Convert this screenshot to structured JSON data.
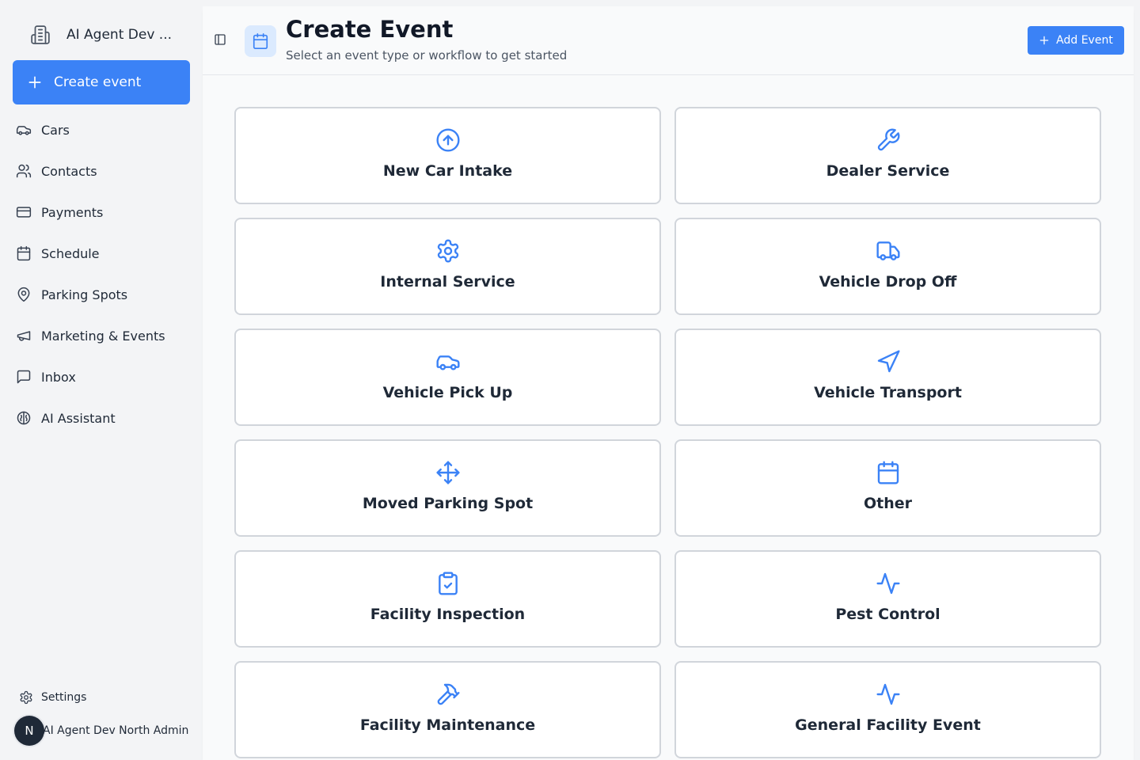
{
  "sidebar": {
    "org_name": "AI Agent Dev ...",
    "create_label": "Create event",
    "items": [
      {
        "label": "Cars",
        "icon": "car-icon"
      },
      {
        "label": "Contacts",
        "icon": "users-icon"
      },
      {
        "label": "Payments",
        "icon": "credit-card-icon"
      },
      {
        "label": "Schedule",
        "icon": "calendar-icon"
      },
      {
        "label": "Parking Spots",
        "icon": "map-pin-icon"
      },
      {
        "label": "Marketing & Events",
        "icon": "megaphone-icon"
      },
      {
        "label": "Inbox",
        "icon": "message-square-icon"
      },
      {
        "label": "AI Assistant",
        "icon": "brain-icon"
      }
    ],
    "settings_label": "Settings",
    "user_initial": "N",
    "user_name": "AI Agent Dev North Admin"
  },
  "header": {
    "title": "Create Event",
    "subtitle": "Select an event type or workflow to get started",
    "add_label": "Add Event"
  },
  "event_types": [
    {
      "label": "New Car Intake",
      "icon": "arrow-up-circle-icon"
    },
    {
      "label": "Dealer Service",
      "icon": "wrench-icon"
    },
    {
      "label": "Internal Service",
      "icon": "gear-icon"
    },
    {
      "label": "Vehicle Drop Off",
      "icon": "truck-icon"
    },
    {
      "label": "Vehicle Pick Up",
      "icon": "car-icon"
    },
    {
      "label": "Vehicle Transport",
      "icon": "navigation-icon"
    },
    {
      "label": "Moved Parking Spot",
      "icon": "move-icon"
    },
    {
      "label": "Other",
      "icon": "calendar-icon"
    },
    {
      "label": "Facility Inspection",
      "icon": "clipboard-check-icon"
    },
    {
      "label": "Pest Control",
      "icon": "activity-icon"
    },
    {
      "label": "Facility Maintenance",
      "icon": "hammer-icon"
    },
    {
      "label": "General Facility Event",
      "icon": "activity-icon"
    }
  ],
  "colors": {
    "accent": "#3b82f6",
    "icon_blue": "#3b82f6",
    "text": "#1f2937"
  }
}
